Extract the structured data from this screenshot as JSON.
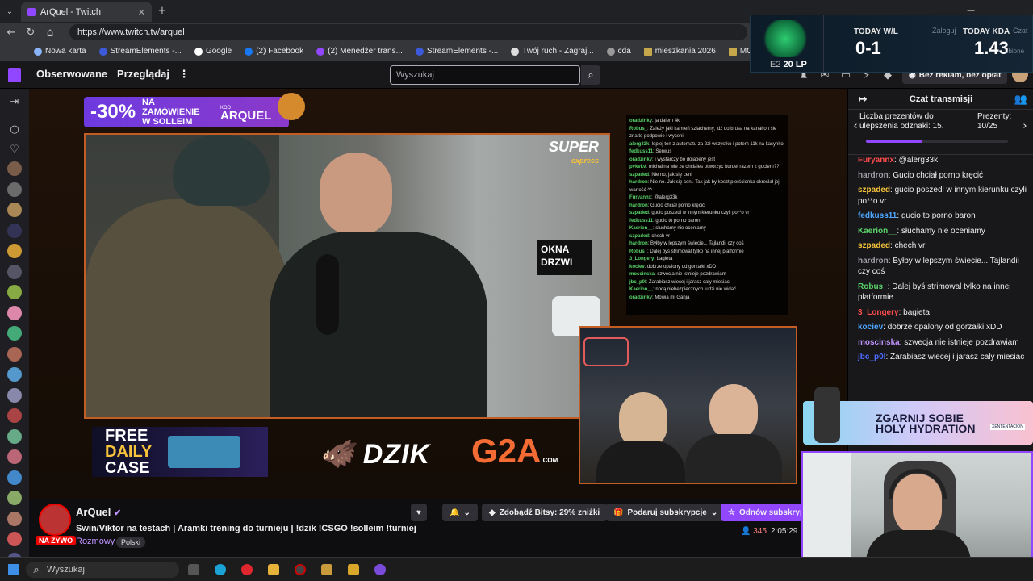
{
  "browser": {
    "tab_title": "ArQuel - Twitch",
    "url": "https://www.twitch.tv/arquel",
    "bookmarks": [
      "Nowa karta",
      "StreamElements -...",
      "Google",
      "(2) Facebook",
      "(2) Menedżer trans...",
      "StreamElements -...",
      "Twój ruch - Zagraj...",
      "cda",
      "mieszkania 2026",
      "MOJE"
    ]
  },
  "twitch_nav": {
    "following": "Obserwowane",
    "browse": "Przeglądaj",
    "search_placeholder": "Wyszukaj",
    "ad_free": "Bez reklam, bez opłat"
  },
  "stream_overlay": {
    "promo_pct": "-30%",
    "promo_text_1": "NA ZAMÓWIENIE",
    "promo_text_2": "W SOLLEIM",
    "promo_code_label": "KOD",
    "promo_code": "ARQUEL",
    "super_express": "SUPER",
    "super_express_sub": "express",
    "store_sign_1": "OKNA",
    "store_sign_2": "DRZWI",
    "free_case_1": "FREE",
    "free_case_2": "DAILY",
    "free_case_3": "CASE",
    "sponsor_1": "DZIK",
    "sponsor_2": "G2A",
    "sponsor_2_sub": ".COM",
    "chat_lines": [
      {
        "user": "oradzinky",
        "text": "ja dalem 4k"
      },
      {
        "user": "Robus_",
        "text": "Zależy jaki kamień szlachetny, idź do brusa na kanał on sie zna to podpowie i wyceni"
      },
      {
        "user": "alerg33k",
        "text": "lepiej ten z automatu za 2zł wszystko i potem 11k na kasynko"
      },
      {
        "user": "fedkuss11",
        "text": "Serwus"
      },
      {
        "user": "oradzinky",
        "text": "i wystarczy bo dojabeny jest"
      },
      {
        "user": "pvkvkv",
        "text": "michalina wie ze chciales otworzyc burdel razem z gociem??"
      },
      {
        "user": "szpaded",
        "text": "Nie no, jak się ceni"
      },
      {
        "user": "hardron",
        "text": "Nie no. Jak się ceni. Tak jak by koszt pierścionka określał jej wartość ^^"
      },
      {
        "user": "Furyannx",
        "text": "@alerg33k"
      },
      {
        "user": "hardron",
        "text": "Gucio chciał porno kręcić"
      },
      {
        "user": "szpaded",
        "text": "gucio poszedl w innym kierunku czyli po**o vr"
      },
      {
        "user": "fedkuss11",
        "text": "gucio to porno baron"
      },
      {
        "user": "Kaerion__",
        "text": "słuchamy nie oceniamy"
      },
      {
        "user": "szpaded",
        "text": "chech vr"
      },
      {
        "user": "hardron",
        "text": "Byłby w lepszym świecie... Tajlandii czy coś"
      },
      {
        "user": "Robus_",
        "text": "Dalej byś strimowal tylko na innej platformie"
      },
      {
        "user": "3_Longery",
        "text": "bagieta"
      },
      {
        "user": "kociev",
        "text": "dobrze opalony od gorzałki xDD"
      },
      {
        "user": "moscinska",
        "text": "szwecja nie istnieje pozdrawiam"
      },
      {
        "user": "jbc_p0l",
        "text": "Zarabiasz wiecej i jarasz caly miesiac"
      },
      {
        "user": "Kaerion__",
        "text": "nocą niebezpiecznych ludzi nie widać"
      },
      {
        "user": "oradzinky",
        "text": "Mowia mi Ganja"
      }
    ]
  },
  "chat": {
    "title": "Czat transmisji",
    "gift_text": "Liczba prezentów do ulepszenia odznaki: 15.",
    "gift_label": "Prezenty:",
    "gift_count": "10/25",
    "messages": [
      {
        "user": "Furyannx",
        "color": "#ff4d4d",
        "text": "@alerg33k"
      },
      {
        "user": "hardron",
        "color": "#a0a0a8",
        "text": "Gucio chciał porno kręcić"
      },
      {
        "user": "szpaded",
        "color": "#f6c33a",
        "text": "gucio poszedl w innym kierunku czyli po**o vr"
      },
      {
        "user": "fedkuss11",
        "color": "#4da6ff",
        "text": "gucio to porno baron"
      },
      {
        "user": "Kaerion__",
        "color": "#59d36a",
        "text": "słuchamy nie oceniamy"
      },
      {
        "user": "szpaded",
        "color": "#f6c33a",
        "text": "chech vr"
      },
      {
        "user": "hardron",
        "color": "#a0a0a8",
        "text": "Byłby w lepszym świecie... Tajlandii czy coś"
      },
      {
        "user": "Robus_",
        "color": "#59d36a",
        "text": "Dalej byś strimowal tylko na innej platformie"
      },
      {
        "user": "3_Longery",
        "color": "#ff4d4d",
        "text": "bagieta"
      },
      {
        "user": "kociev",
        "color": "#4da6ff",
        "text": "dobrze opalony od gorzałki xDD"
      },
      {
        "user": "moscinska",
        "color": "#bf94ff",
        "text": "szwecja nie istnieje pozdrawiam"
      },
      {
        "user": "jbc_p0l",
        "color": "#4d6bff",
        "text": "Zarabiasz wiecej i jarasz caly miesiac"
      }
    ]
  },
  "stream_info": {
    "channel": "ArQuel",
    "title": "Swin/Viktor na testach | Aramki trening do turnieju | !dzik !CSGO !solleim !turniej",
    "category": "Rozmowy",
    "tag": "Polski",
    "live_badge": "NA ŻYWO",
    "viewers": "345",
    "uptime": "2:05:29",
    "bits_button": "Zdobądź Bitsy: 29% zniżki",
    "gift_sub_button": "Podaruj subskrypcję",
    "sub_button": "Odnów subskrypcję"
  },
  "rank_overlay": {
    "tier": "E2",
    "lp": "20 LP",
    "wl_label": "TODAY W/L",
    "wl_value": "0-1",
    "kda_label": "TODAY KDA",
    "kda_value": "1.43",
    "behind_login": "Zaloguj",
    "behind_chat": "Czat",
    "behind_sub": "ubione"
  },
  "hydration_ad": {
    "line1": "ZGARNIJ SOBIE",
    "line2": "HOLY HYDRATION",
    "tag": "XENTENTACION"
  },
  "taskbar": {
    "search_placeholder": "Wyszukaj"
  }
}
